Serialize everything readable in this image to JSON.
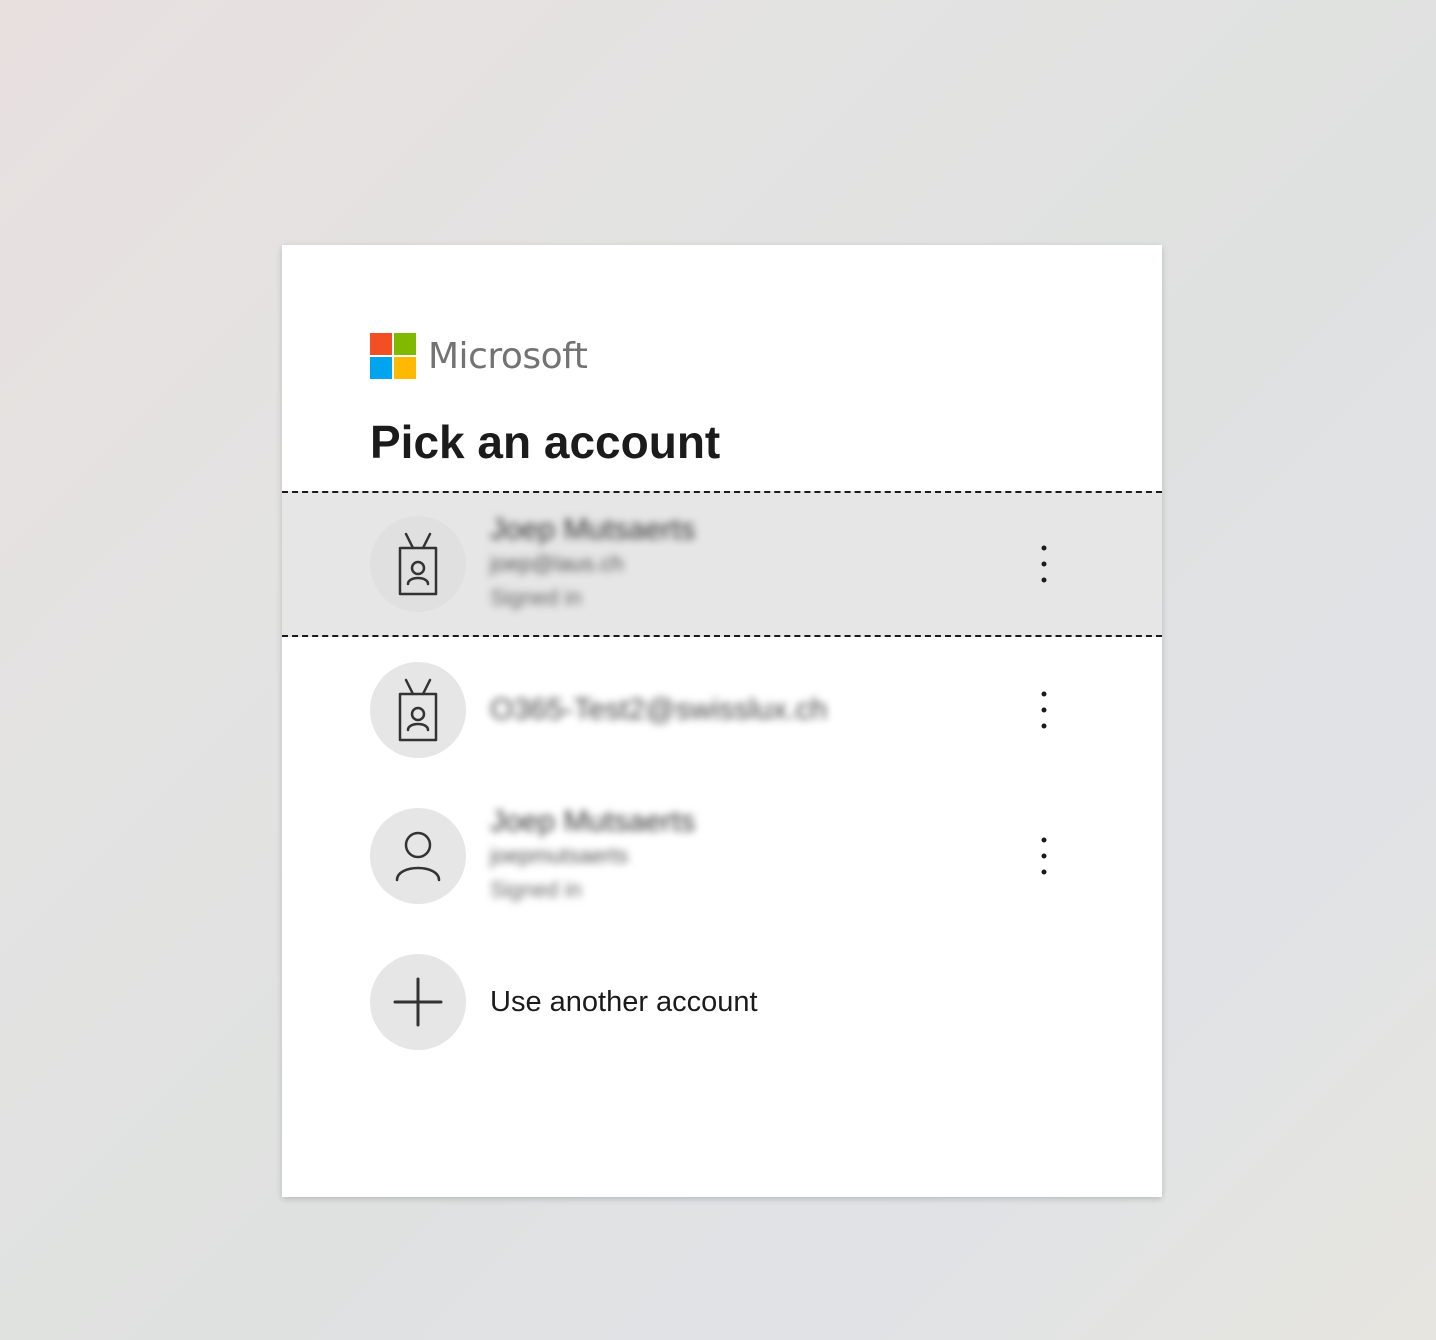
{
  "brand": {
    "name": "Microsoft",
    "colors": [
      "#f25022",
      "#7fba00",
      "#00a4ef",
      "#ffb900"
    ]
  },
  "page": {
    "title": "Pick an account"
  },
  "accounts": [
    {
      "icon": "badge-icon",
      "name": "Joep Mutsaerts",
      "email": "joep@laus.ch",
      "status": "Signed in",
      "selected": true
    },
    {
      "icon": "badge-icon",
      "email": "O365-Test2@swisslux.ch"
    },
    {
      "icon": "person-icon",
      "name": "Joep Mutsaerts",
      "email": "joepmutsaerts",
      "status": "Signed in"
    }
  ],
  "add_account": {
    "icon": "plus-icon",
    "label": "Use another account"
  },
  "menu": {
    "icon": "more-vertical-icon"
  }
}
